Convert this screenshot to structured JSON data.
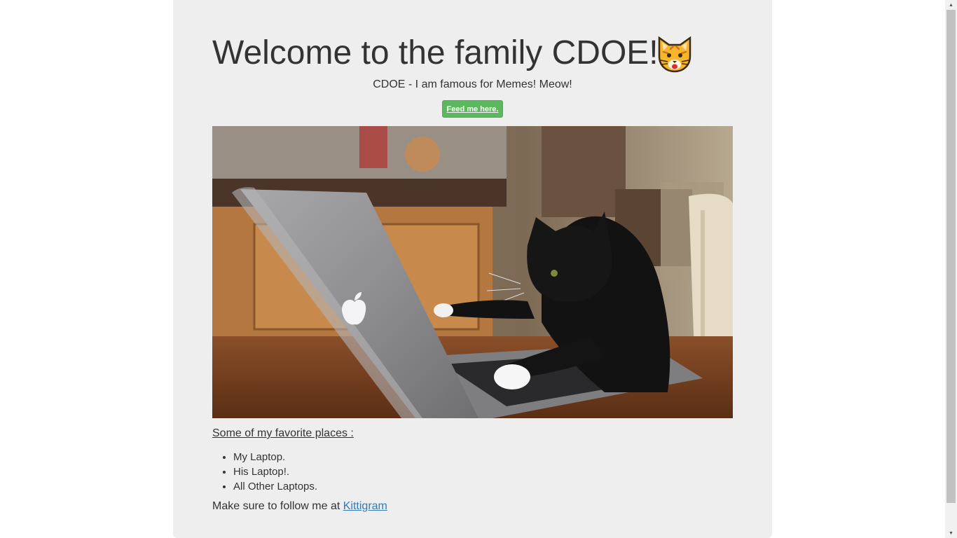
{
  "header": {
    "title": "Welcome to the family CDOE!",
    "emoji_icon": "cat-face-icon",
    "subtitle": "CDOE - I am famous for Memes! Meow!",
    "feed_button_label": "Feed me here."
  },
  "image": {
    "alt": "cat typing on laptop",
    "icon": "cat-laptop-photo"
  },
  "places": {
    "heading": "Some of my favorite places :",
    "items": [
      "My Laptop.",
      "His Laptop!.",
      "All Other Laptops."
    ]
  },
  "follow": {
    "prefix": "Make sure to follow me at",
    "link_label": "Kittigram"
  },
  "colors": {
    "background": "#eeeeee",
    "button": "#5cb85c",
    "link": "#337ab7"
  }
}
